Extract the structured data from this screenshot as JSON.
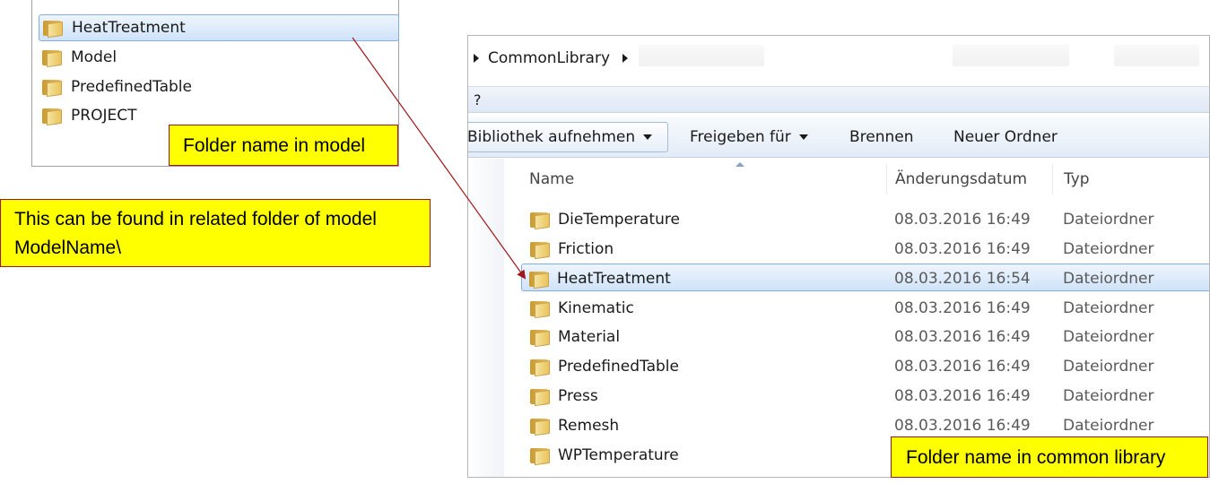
{
  "model_tree": {
    "items": [
      {
        "label": "HeatTreatment",
        "selected": true
      },
      {
        "label": "Model",
        "selected": false
      },
      {
        "label": "PredefinedTable",
        "selected": false
      },
      {
        "label": "PROJECT",
        "selected": false
      }
    ]
  },
  "callouts": {
    "model_folder": "Folder name in model",
    "related_line1": "This can be found in related folder of model",
    "related_line2": "ModelName\\",
    "common_library": "Folder name in common library"
  },
  "explorer": {
    "breadcrumb": "CommonLibrary",
    "menu_help": "?",
    "toolbar": {
      "library_label": "Bibliothek aufnehmen",
      "share_label": "Freigeben für",
      "burn_label": "Brennen",
      "new_folder_label": "Neuer Ordner"
    },
    "columns": {
      "name": "Name",
      "date": "Änderungsdatum",
      "type": "Typ"
    },
    "rows": [
      {
        "name": "DieTemperature",
        "date": "08.03.2016 16:49",
        "type": "Dateiordner",
        "selected": false
      },
      {
        "name": "Friction",
        "date": "08.03.2016 16:49",
        "type": "Dateiordner",
        "selected": false
      },
      {
        "name": "HeatTreatment",
        "date": "08.03.2016 16:54",
        "type": "Dateiordner",
        "selected": true
      },
      {
        "name": "Kinematic",
        "date": "08.03.2016 16:49",
        "type": "Dateiordner",
        "selected": false
      },
      {
        "name": "Material",
        "date": "08.03.2016 16:49",
        "type": "Dateiordner",
        "selected": false
      },
      {
        "name": "PredefinedTable",
        "date": "08.03.2016 16:49",
        "type": "Dateiordner",
        "selected": false
      },
      {
        "name": "Press",
        "date": "08.03.2016 16:49",
        "type": "Dateiordner",
        "selected": false
      },
      {
        "name": "Remesh",
        "date": "08.03.2016 16:49",
        "type": "Dateiordner",
        "selected": false
      },
      {
        "name": "WPTemperature",
        "date": "",
        "type": "",
        "selected": false
      }
    ]
  },
  "colors": {
    "callout_fill": "#ffff00",
    "callout_border": "#a0161a",
    "arrow": "#a0161a",
    "selection": "#cfe3f9"
  }
}
